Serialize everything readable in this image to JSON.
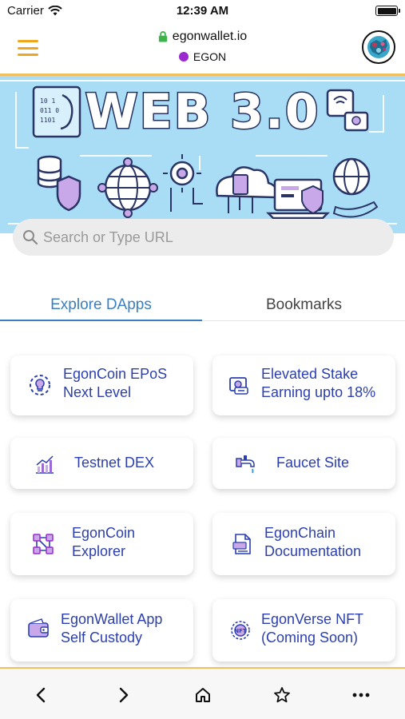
{
  "status_bar": {
    "carrier": "Carrier",
    "time": "12:39 AM"
  },
  "header": {
    "url": "egonwallet.io",
    "network": "EGON",
    "network_color": "#9b2bd0",
    "accent_color": "#f0a51e",
    "menu_icon": "hamburger-menu-icon",
    "lock_icon": "lock-icon"
  },
  "banner": {
    "title": "WEB 3.0",
    "background_color": "#a9dcf5"
  },
  "search": {
    "placeholder": "Search or Type URL"
  },
  "tabs": [
    {
      "label": "Explore DApps",
      "active": true
    },
    {
      "label": "Bookmarks",
      "active": false
    }
  ],
  "cards": [
    {
      "line1": "EgonCoin EPoS",
      "line2": "Next Level",
      "icon": "lightbulb-icon"
    },
    {
      "line1": "Elevated Stake",
      "line2": "Earning upto 18%",
      "icon": "stake-icon"
    },
    {
      "line1": "Testnet DEX",
      "line2": "",
      "icon": "chart-icon"
    },
    {
      "line1": "Faucet Site",
      "line2": "",
      "icon": "faucet-icon"
    },
    {
      "line1": "EgonCoin",
      "line2": "Explorer",
      "icon": "network-explorer-icon"
    },
    {
      "line1": "EgonChain",
      "line2": "Documentation",
      "icon": "document-icon"
    },
    {
      "line1": "EgonWallet App",
      "line2": "Self Custody",
      "icon": "wallet-icon"
    },
    {
      "line1": "EgonVerse NFT",
      "line2": "(Coming Soon)",
      "icon": "nft-icon"
    }
  ],
  "bottom_nav": [
    {
      "name": "back",
      "icon": "chevron-left-icon"
    },
    {
      "name": "forward",
      "icon": "chevron-right-icon"
    },
    {
      "name": "home",
      "icon": "home-icon"
    },
    {
      "name": "bookmark",
      "icon": "star-icon"
    },
    {
      "name": "more",
      "icon": "more-dots-icon"
    }
  ]
}
